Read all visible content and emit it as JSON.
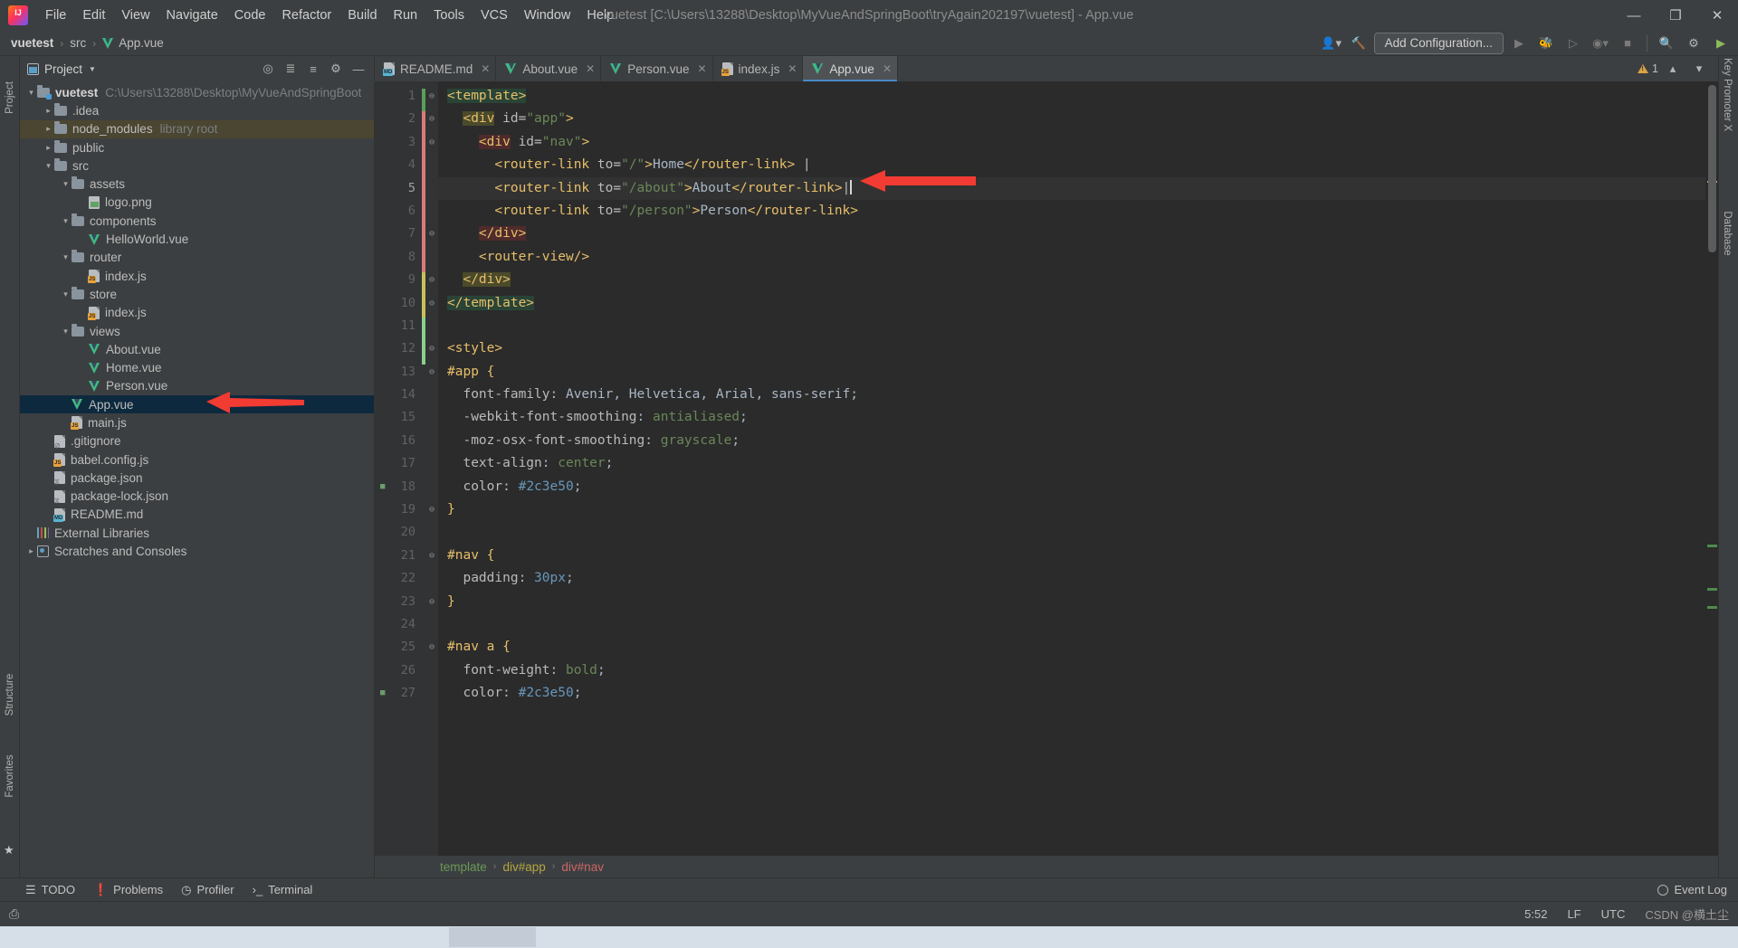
{
  "window": {
    "title": "vuetest [C:\\Users\\13288\\Desktop\\MyVueAndSpringBoot\\tryAgain202197\\vuetest] - App.vue",
    "minimize": "—",
    "maximize": "❐",
    "close": "✕"
  },
  "menu": [
    {
      "label": "File"
    },
    {
      "label": "Edit"
    },
    {
      "label": "View"
    },
    {
      "label": "Navigate"
    },
    {
      "label": "Code"
    },
    {
      "label": "Refactor"
    },
    {
      "label": "Build"
    },
    {
      "label": "Run"
    },
    {
      "label": "Tools"
    },
    {
      "label": "VCS"
    },
    {
      "label": "Window"
    },
    {
      "label": "Help"
    }
  ],
  "navbar": {
    "crumbs": [
      "vuetest",
      "src",
      "App.vue"
    ],
    "add_configuration": "Add Configuration...",
    "separator": "›"
  },
  "rails": {
    "left": {
      "project": "Project",
      "structure": "Structure",
      "favorites": "Favorites"
    },
    "right": {
      "key_promoter": "Key Promoter X",
      "database": "Database"
    }
  },
  "project_panel": {
    "title": "Project",
    "tree": [
      {
        "label": "vuetest",
        "note": "C:\\Users\\13288\\Desktop\\MyVueAndSpringBoot",
        "indent": 0,
        "arrow": "down",
        "icon": "folder-module",
        "bold": true
      },
      {
        "label": ".idea",
        "note": "",
        "indent": 1,
        "arrow": "right",
        "icon": "folder"
      },
      {
        "label": "node_modules",
        "note": "library root",
        "indent": 1,
        "arrow": "right",
        "icon": "folder",
        "highlight": "library"
      },
      {
        "label": "public",
        "note": "",
        "indent": 1,
        "arrow": "right",
        "icon": "folder"
      },
      {
        "label": "src",
        "note": "",
        "indent": 1,
        "arrow": "down",
        "icon": "folder"
      },
      {
        "label": "assets",
        "note": "",
        "indent": 2,
        "arrow": "down",
        "icon": "folder"
      },
      {
        "label": "logo.png",
        "note": "",
        "indent": 3,
        "arrow": "none",
        "icon": "image"
      },
      {
        "label": "components",
        "note": "",
        "indent": 2,
        "arrow": "down",
        "icon": "folder"
      },
      {
        "label": "HelloWorld.vue",
        "note": "",
        "indent": 3,
        "arrow": "none",
        "icon": "vue"
      },
      {
        "label": "router",
        "note": "",
        "indent": 2,
        "arrow": "down",
        "icon": "folder"
      },
      {
        "label": "index.js",
        "note": "",
        "indent": 3,
        "arrow": "none",
        "icon": "js"
      },
      {
        "label": "store",
        "note": "",
        "indent": 2,
        "arrow": "down",
        "icon": "folder"
      },
      {
        "label": "index.js",
        "note": "",
        "indent": 3,
        "arrow": "none",
        "icon": "js"
      },
      {
        "label": "views",
        "note": "",
        "indent": 2,
        "arrow": "down",
        "icon": "folder"
      },
      {
        "label": "About.vue",
        "note": "",
        "indent": 3,
        "arrow": "none",
        "icon": "vue"
      },
      {
        "label": "Home.vue",
        "note": "",
        "indent": 3,
        "arrow": "none",
        "icon": "vue"
      },
      {
        "label": "Person.vue",
        "note": "",
        "indent": 3,
        "arrow": "none",
        "icon": "vue"
      },
      {
        "label": "App.vue",
        "note": "",
        "indent": 2,
        "arrow": "none",
        "icon": "vue",
        "selected": true
      },
      {
        "label": "main.js",
        "note": "",
        "indent": 2,
        "arrow": "none",
        "icon": "js"
      },
      {
        "label": ".gitignore",
        "note": "",
        "indent": 1,
        "arrow": "none",
        "icon": "gitignore"
      },
      {
        "label": "babel.config.js",
        "note": "",
        "indent": 1,
        "arrow": "none",
        "icon": "js"
      },
      {
        "label": "package.json",
        "note": "",
        "indent": 1,
        "arrow": "none",
        "icon": "json"
      },
      {
        "label": "package-lock.json",
        "note": "",
        "indent": 1,
        "arrow": "none",
        "icon": "json"
      },
      {
        "label": "README.md",
        "note": "",
        "indent": 1,
        "arrow": "none",
        "icon": "md"
      },
      {
        "label": "External Libraries",
        "note": "",
        "indent": 0,
        "arrow": "none",
        "icon": "libs"
      },
      {
        "label": "Scratches and Consoles",
        "note": "",
        "indent": 0,
        "arrow": "right",
        "icon": "scratches"
      }
    ]
  },
  "editor": {
    "tabs": [
      {
        "label": "README.md",
        "icon": "md",
        "active": false
      },
      {
        "label": "About.vue",
        "icon": "vue",
        "active": false
      },
      {
        "label": "Person.vue",
        "icon": "vue",
        "active": false
      },
      {
        "label": "index.js",
        "icon": "js",
        "active": false
      },
      {
        "label": "App.vue",
        "icon": "vue",
        "active": true
      }
    ],
    "close_glyph": "✕",
    "warning_count": "1",
    "lines": [
      {
        "n": 1,
        "text": "<template>"
      },
      {
        "n": 2,
        "text": "  <div id=\"app\">"
      },
      {
        "n": 3,
        "text": "    <div id=\"nav\">"
      },
      {
        "n": 4,
        "text": "      <router-link to=\"/\">Home</router-link> |"
      },
      {
        "n": 5,
        "text": "      <router-link to=\"/about\">About</router-link>|"
      },
      {
        "n": 6,
        "text": "      <router-link to=\"/person\">Person</router-link>"
      },
      {
        "n": 7,
        "text": "    </div>"
      },
      {
        "n": 8,
        "text": "    <router-view/>"
      },
      {
        "n": 9,
        "text": "  </div>"
      },
      {
        "n": 10,
        "text": "</template>"
      },
      {
        "n": 11,
        "text": ""
      },
      {
        "n": 12,
        "text": "<style>"
      },
      {
        "n": 13,
        "text": "#app {"
      },
      {
        "n": 14,
        "text": "  font-family: Avenir, Helvetica, Arial, sans-serif;"
      },
      {
        "n": 15,
        "text": "  -webkit-font-smoothing: antialiased;"
      },
      {
        "n": 16,
        "text": "  -moz-osx-font-smoothing: grayscale;"
      },
      {
        "n": 17,
        "text": "  text-align: center;"
      },
      {
        "n": 18,
        "text": "  color: #2c3e50;"
      },
      {
        "n": 19,
        "text": "}"
      },
      {
        "n": 20,
        "text": ""
      },
      {
        "n": 21,
        "text": "#nav {"
      },
      {
        "n": 22,
        "text": "  padding: 30px;"
      },
      {
        "n": 23,
        "text": "}"
      },
      {
        "n": 24,
        "text": ""
      },
      {
        "n": 25,
        "text": "#nav a {"
      },
      {
        "n": 26,
        "text": "  font-weight: bold;"
      },
      {
        "n": 27,
        "text": "  color: #2c3e50;"
      }
    ],
    "current_line": 5,
    "breadcrumbs": [
      "template",
      "div#app",
      "div#nav"
    ],
    "breadcrumb_sep": "›"
  },
  "bottom_bar": {
    "items": [
      {
        "label": "TODO",
        "icon": "list-icon"
      },
      {
        "label": "Problems",
        "icon": "problems-icon"
      },
      {
        "label": "Profiler",
        "icon": "profiler-icon"
      },
      {
        "label": "Terminal",
        "icon": "terminal-icon"
      }
    ],
    "event_log": "Event Log"
  },
  "status_bar": {
    "caret": "5:52",
    "line_separator": "LF",
    "encoding": "UTC",
    "watermark": "CSDN @横土尘"
  },
  "colors": {
    "accent": "#4a88c7",
    "selection": "#0d293e",
    "vue_green": "#41b883",
    "arrow_red": "#f23b32",
    "warning": "#d9a343"
  }
}
